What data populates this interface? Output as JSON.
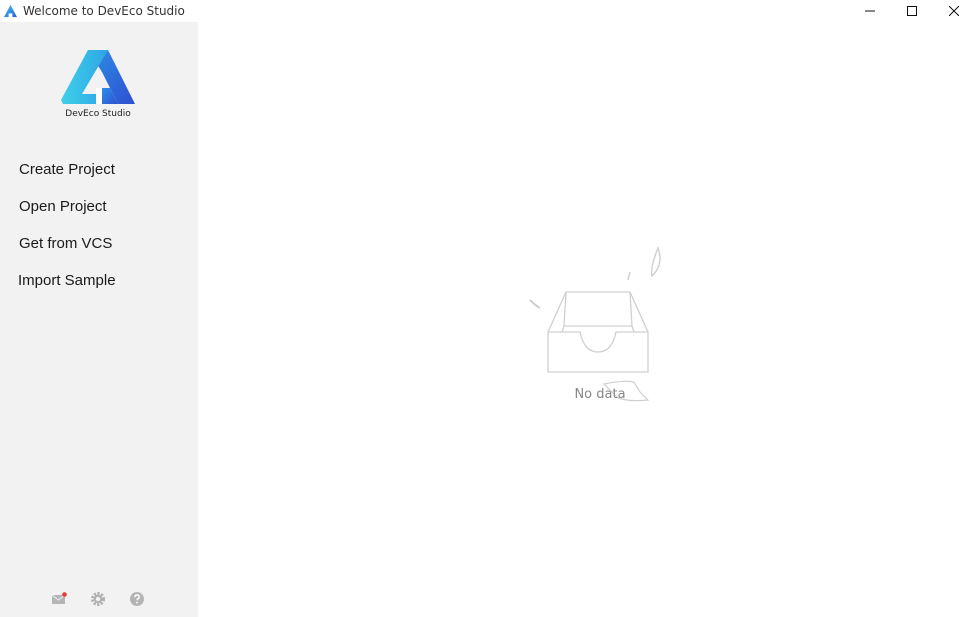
{
  "window": {
    "title": "Welcome to DevEco Studio",
    "controls": [
      "minimize",
      "maximize",
      "close"
    ]
  },
  "sidebar": {
    "logo_text": "DevEco Studio",
    "items": [
      {
        "label": "Create Project"
      },
      {
        "label": "Open Project"
      },
      {
        "label": "Get from VCS"
      },
      {
        "label": "Import Sample"
      }
    ],
    "bottom_icons": [
      "mail-icon",
      "settings-icon",
      "help-icon"
    ]
  },
  "main": {
    "empty_text": "No data"
  },
  "colors": {
    "sidebar_bg": "#f2f2f2",
    "logo_light": "#3cc7e6",
    "logo_dark": "#2f5fd8",
    "notification_dot": "#e53935"
  }
}
